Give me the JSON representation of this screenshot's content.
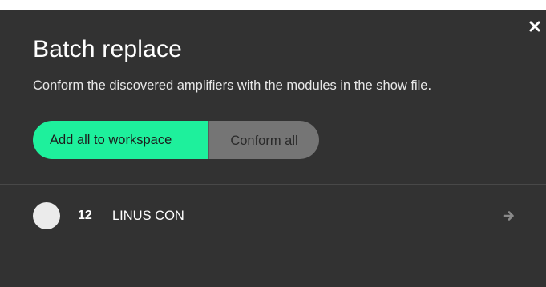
{
  "dialog": {
    "title": "Batch replace",
    "subtitle": "Conform the discovered amplifiers with the modules in the show file.",
    "close_icon": "close-icon",
    "buttons": {
      "add_all_label": "Add all to workspace",
      "conform_all_label": "Conform all"
    }
  },
  "list": {
    "items": [
      {
        "number": "12",
        "name": "LINUS CON",
        "status_icon": "status-circle-icon",
        "action_icon": "arrow-right-icon"
      }
    ]
  },
  "colors": {
    "background": "#323232",
    "primary_accent": "#1ef09c",
    "secondary_button": "#757575"
  }
}
